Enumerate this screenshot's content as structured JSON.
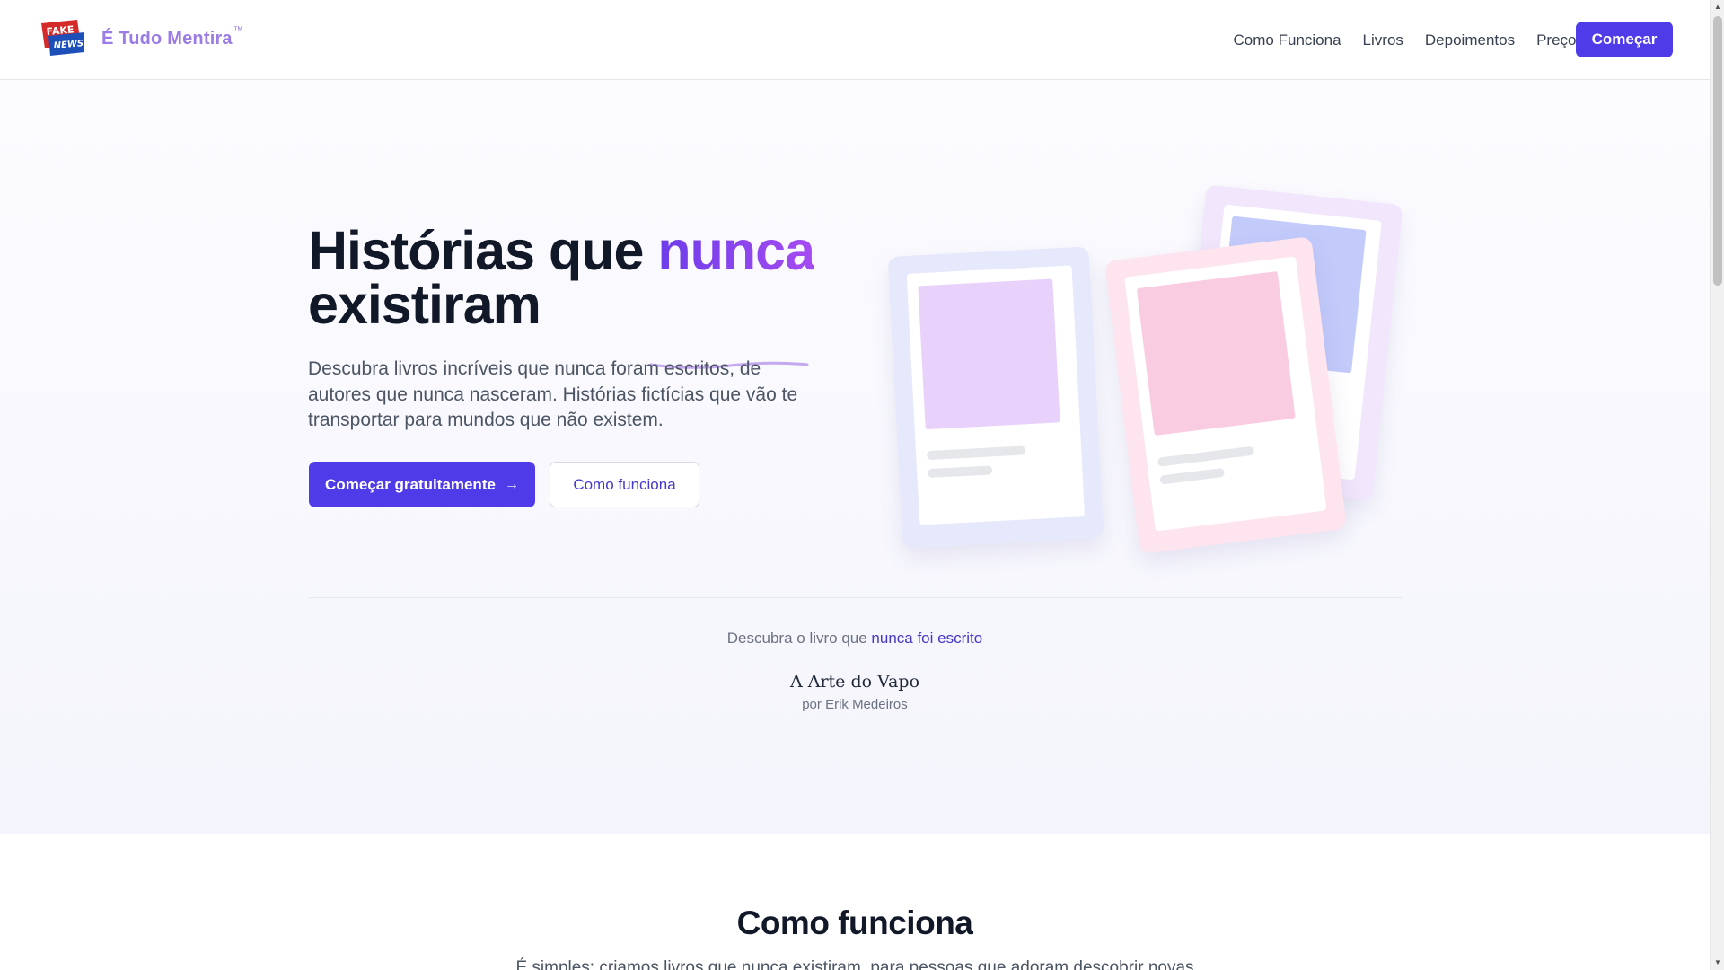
{
  "header": {
    "brand": "É Tudo Mentira",
    "brand_mark": "™",
    "logo_text_top": "FAKE",
    "logo_text_bottom": "NEWS",
    "nav": [
      "Como Funciona",
      "Livros",
      "Depoimentos",
      "Preços"
    ],
    "cta": "Começar"
  },
  "hero": {
    "title_part1": "Histórias que ",
    "title_accent": "nunca",
    "title_part2": "existiram",
    "description": "Descubra livros incríveis que nunca foram escritos, de autores que nunca nasceram. Histórias fictícias que vão te transportar para mundos que não existem.",
    "primary_button": "Começar gratuitamente",
    "primary_button_icon": "arrow-right-icon",
    "secondary_button": "Como funciona"
  },
  "discover": {
    "prefix": "Descubra o livro que ",
    "highlight": "nunca foi escrito",
    "book_title": "A Arte do Vapo",
    "book_author": "por Erik Medeiros"
  },
  "section2": {
    "title": "Como funciona",
    "text": "É simples: criamos livros que nunca existiram, para pessoas que adoram descobrir novas"
  },
  "colors": {
    "accent": "#4f3be8",
    "brand": "#9b7be6",
    "card_blue": "#e6e8fb",
    "card_pink": "#fde4ef",
    "card_lilac": "#f1e6fb"
  }
}
